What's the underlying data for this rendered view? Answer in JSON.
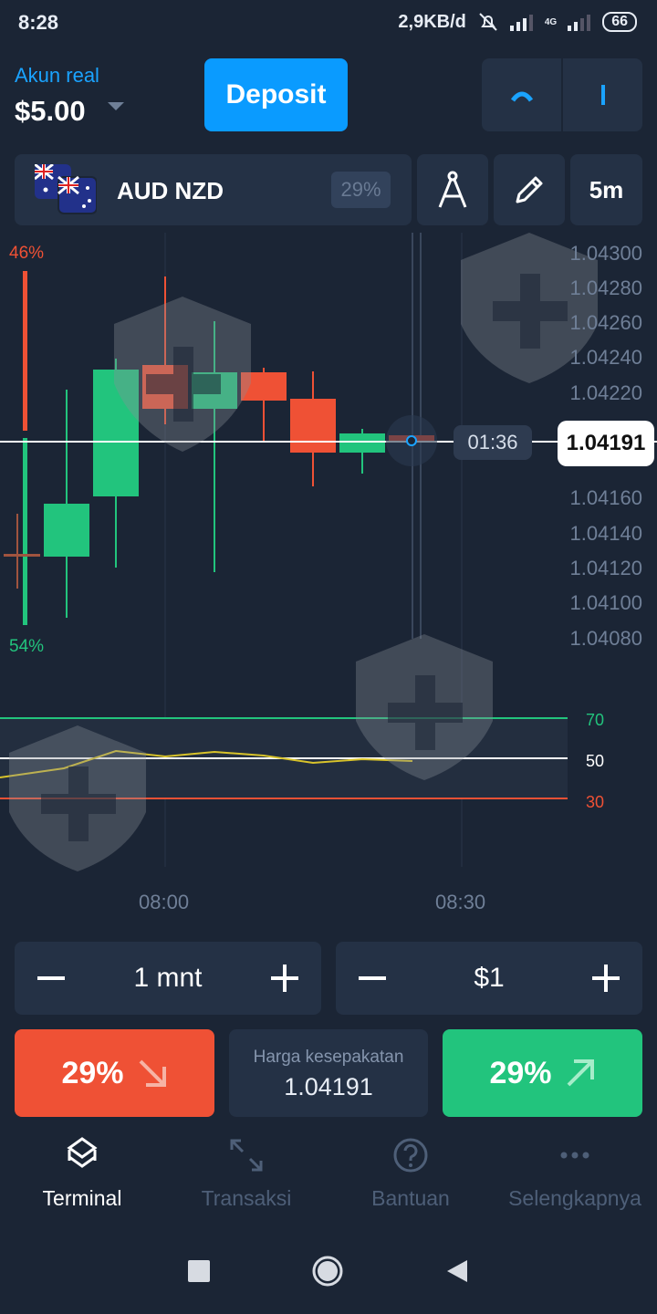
{
  "status_bar": {
    "time": "8:28",
    "net_speed": "2,9KB/d",
    "network": "4G",
    "battery": "66"
  },
  "account": {
    "label": "Akun real",
    "balance": "$5.00"
  },
  "deposit_label": "Deposit",
  "asset": {
    "name": "AUD NZD",
    "payout": "29%",
    "timeframe": "5m"
  },
  "chart": {
    "sentiment_top": "46%",
    "sentiment_bottom": "54%",
    "current_price": "1.04191",
    "countdown": "01:36",
    "y_ticks": [
      "1.04300",
      "1.04280",
      "1.04260",
      "1.04240",
      "1.04220",
      "1.04160",
      "1.04140",
      "1.04120",
      "1.04100",
      "1.04080"
    ],
    "x_ticks": [
      "08:00",
      "08:30"
    ],
    "rsi_levels": [
      "70",
      "50",
      "30"
    ],
    "colors": {
      "up": "#22c47d",
      "down": "#ef5135",
      "rsi_line": "#d8c32b"
    }
  },
  "trade": {
    "duration": "1 mnt",
    "amount": "$1",
    "sell_payout": "29%",
    "buy_payout": "29%",
    "strike_label": "Harga kesepakatan",
    "strike_value": "1.04191"
  },
  "nav": {
    "terminal": "Terminal",
    "transactions": "Transaksi",
    "help": "Bantuan",
    "more": "Selengkapnya"
  }
}
